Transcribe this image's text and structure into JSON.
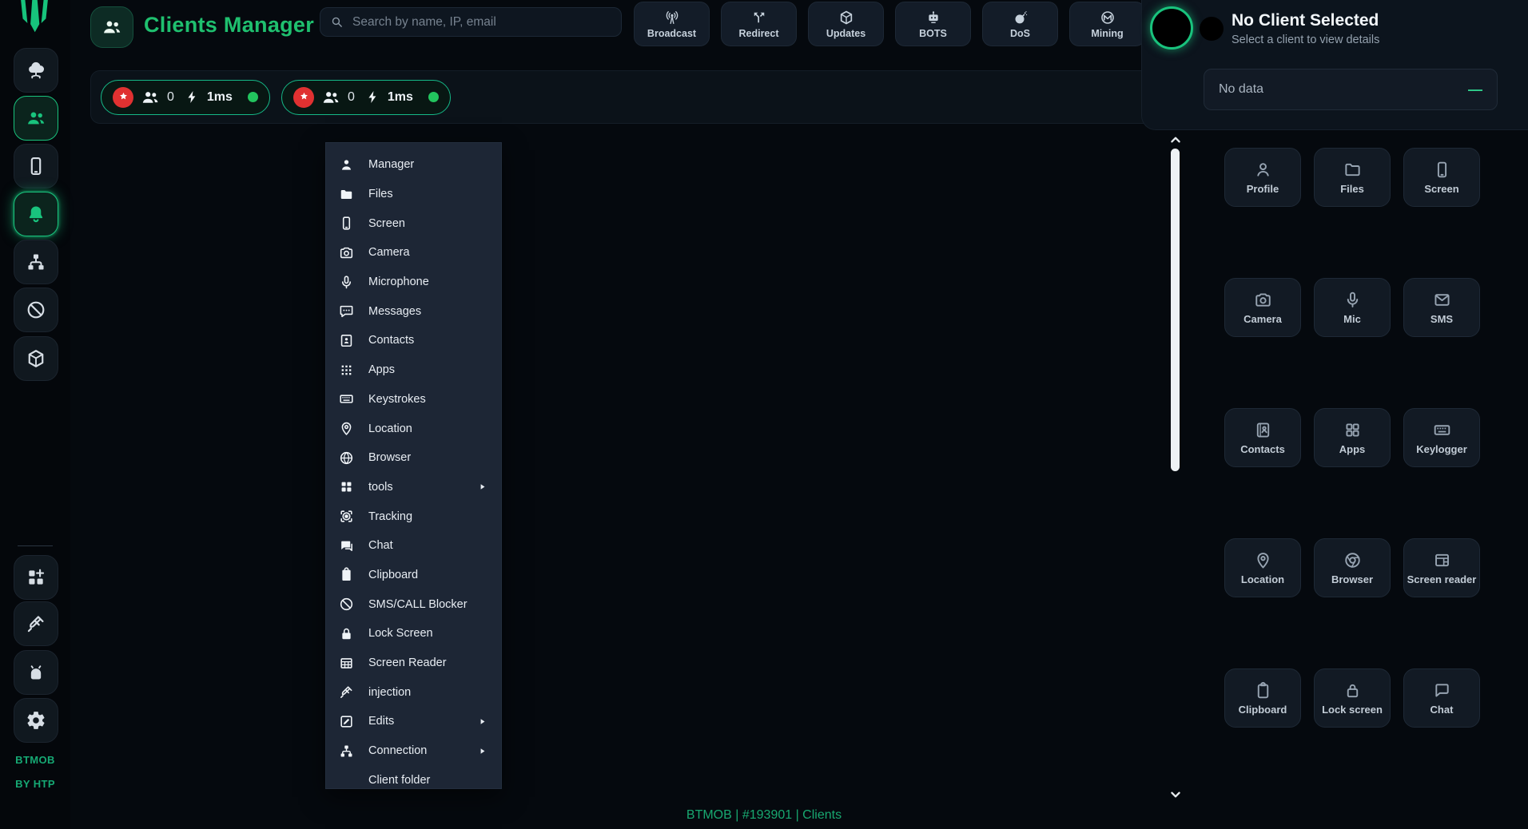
{
  "colors": {
    "accent_green": "#19c37d",
    "danger_red": "#e03131",
    "title_green": "#1fc06f",
    "menu_bg": "#1d2635"
  },
  "sidebar": {
    "brand_line1": "BTMOB",
    "brand_line2": "BY HTP",
    "items": [
      {
        "name": "cloud",
        "icon": "cloudnet",
        "active": false
      },
      {
        "name": "clients",
        "icon": "people",
        "active": true
      },
      {
        "name": "device",
        "icon": "smartphone",
        "active": false
      },
      {
        "name": "notifications",
        "icon": "bell",
        "active": true
      },
      {
        "name": "network",
        "icon": "network",
        "active": false
      },
      {
        "name": "blocker",
        "icon": "block",
        "active": false
      },
      {
        "name": "updates",
        "icon": "package",
        "active": false
      }
    ],
    "bottom_items": [
      {
        "name": "apps",
        "icon": "grid-plus"
      },
      {
        "name": "injection",
        "icon": "syringe"
      },
      {
        "name": "android",
        "icon": "android"
      },
      {
        "name": "settings",
        "icon": "gear"
      }
    ]
  },
  "header": {
    "title": "Clients Manager",
    "search_placeholder": "Search by name, IP, email",
    "actions": [
      {
        "label": "Broadcast",
        "icon": "broadcast"
      },
      {
        "label": "Redirect",
        "icon": "redirect"
      },
      {
        "label": "Updates",
        "icon": "package-down"
      },
      {
        "label": "BOTS",
        "icon": "robot"
      },
      {
        "label": "DoS",
        "icon": "bomb"
      },
      {
        "label": "Mining",
        "icon": "monero"
      }
    ]
  },
  "status_bar": {
    "pills": [
      {
        "clients_count": "0",
        "latency": "1ms"
      },
      {
        "clients_count": "0",
        "latency": "1ms"
      }
    ]
  },
  "context_menu": {
    "items": [
      {
        "label": "Manager",
        "icon": "person"
      },
      {
        "label": "Files",
        "icon": "folder"
      },
      {
        "label": "Screen",
        "icon": "smartphone"
      },
      {
        "label": "Camera",
        "icon": "camera"
      },
      {
        "label": "Microphone",
        "icon": "mic"
      },
      {
        "label": "Messages",
        "icon": "message"
      },
      {
        "label": "Contacts",
        "icon": "contact"
      },
      {
        "label": "Apps",
        "icon": "apps9"
      },
      {
        "label": "Keystrokes",
        "icon": "keyboard"
      },
      {
        "label": "Location",
        "icon": "pin"
      },
      {
        "label": "Browser",
        "icon": "globe"
      },
      {
        "label": "tools",
        "icon": "grid2f",
        "submenu": true
      },
      {
        "label": "Tracking",
        "icon": "tracking"
      },
      {
        "label": "Chat",
        "icon": "chat"
      },
      {
        "label": "Clipboard",
        "icon": "clipboard"
      },
      {
        "label": "SMS/CALL Blocker",
        "icon": "block"
      },
      {
        "label": "Lock Screen",
        "icon": "lock"
      },
      {
        "label": "Screen Reader",
        "icon": "table"
      },
      {
        "label": "injection",
        "icon": "syringe"
      },
      {
        "label": "Edits",
        "icon": "edit",
        "submenu": true
      },
      {
        "label": "Connection",
        "icon": "network",
        "submenu": true
      },
      {
        "label": "Client folder",
        "icon": null
      }
    ]
  },
  "client_panel": {
    "title": "No Client Selected",
    "subtitle": "Select a client to view details",
    "no_data": {
      "label": "No data",
      "indicator": "—"
    },
    "actions": [
      {
        "label": "Profile",
        "icon": "person-o"
      },
      {
        "label": "Files",
        "icon": "folder-o"
      },
      {
        "label": "Screen",
        "icon": "smartphone"
      },
      {
        "label": "Camera",
        "icon": "camera"
      },
      {
        "label": "Mic",
        "icon": "mic"
      },
      {
        "label": "SMS",
        "icon": "mail"
      },
      {
        "label": "Contacts",
        "icon": "contactbook"
      },
      {
        "label": "Apps",
        "icon": "grid4"
      },
      {
        "label": "Keylogger",
        "icon": "keyboard"
      },
      {
        "label": "Location",
        "icon": "pin"
      },
      {
        "label": "Browser",
        "icon": "chrome"
      },
      {
        "label": "Screen reader",
        "icon": "table-sr"
      },
      {
        "label": "Clipboard",
        "icon": "clipboard-o"
      },
      {
        "label": "Lock screen",
        "icon": "lock-o"
      },
      {
        "label": "Chat",
        "icon": "chat-o"
      }
    ]
  },
  "footer": {
    "text": "BTMOB | #193901 | Clients"
  }
}
